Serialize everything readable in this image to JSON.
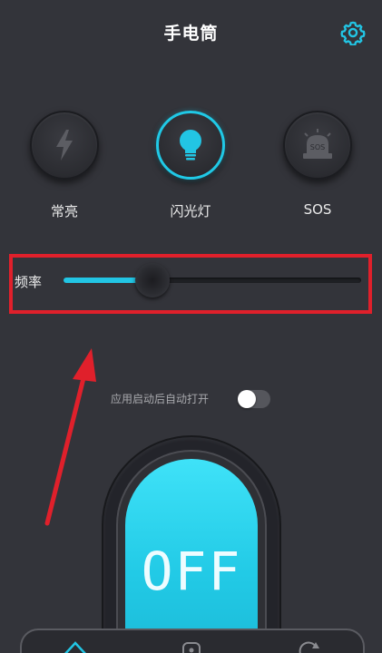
{
  "header": {
    "title": "手电筒",
    "settings_icon": "gear-icon"
  },
  "modes": [
    {
      "label": "常亮",
      "icon": "lightning-icon",
      "active": false
    },
    {
      "label": "闪光灯",
      "icon": "bulb-icon",
      "active": true
    },
    {
      "label": "SOS",
      "icon": "sos-siren-icon",
      "icon_text": "SOS",
      "active": false
    }
  ],
  "frequency": {
    "label": "频率",
    "value": 0.3
  },
  "auto_open": {
    "label": "应用启动后自动打开",
    "on": false
  },
  "power_button": {
    "label": "OFF"
  },
  "bottom_nav": {
    "items": [
      "home-icon",
      "flashlight-icon",
      "refresh-icon"
    ]
  },
  "colors": {
    "background": "#33343a",
    "accent": "#22c5e4",
    "highlight_box": "#e0202b",
    "arrow": "#e0202b"
  }
}
